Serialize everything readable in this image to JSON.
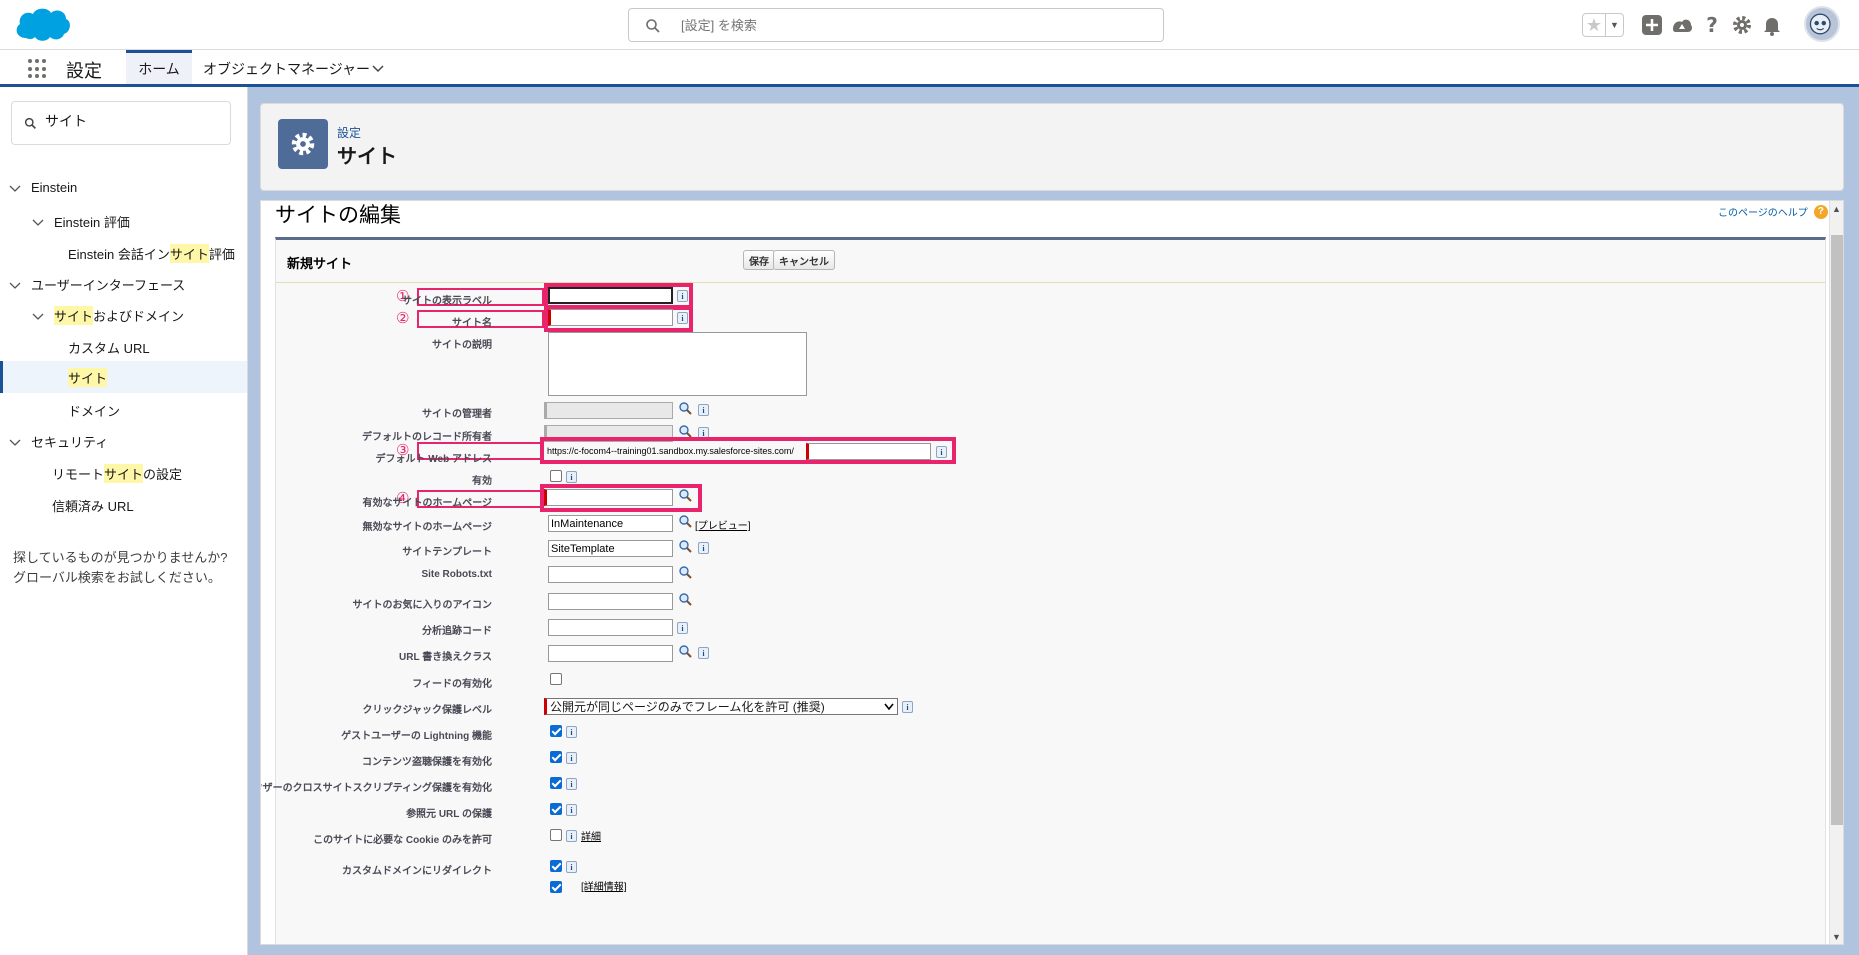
{
  "header": {
    "search_placeholder": "[設定] を検索"
  },
  "nav": {
    "app_name": "設定",
    "home_tab": "ホーム",
    "object_manager_tab": "オブジェクトマネージャー"
  },
  "sidebar": {
    "search_value": "サイト",
    "items": [
      {
        "label": "Einstein"
      },
      {
        "label": "Einstein 評価"
      },
      {
        "label_pre": "Einstein 会話イン",
        "label_hl": "サイト",
        "label_post": "評価"
      },
      {
        "label": "ユーザーインターフェース"
      },
      {
        "label_pre": "",
        "label_hl": "サイト",
        "label_post": "およびドメイン"
      },
      {
        "label": "カスタム URL"
      },
      {
        "label_pre": "",
        "label_hl": "サイト",
        "label_post": ""
      },
      {
        "label": "ドメイン"
      },
      {
        "label": "セキュリティ"
      },
      {
        "label_pre": "リモート",
        "label_hl": "サイト",
        "label_post": "の設定"
      },
      {
        "label": "信頼済み URL"
      }
    ],
    "help_line1": "探しているものが見つかりませんか?",
    "help_line2": "グローバル検索をお試しください。"
  },
  "page_header": {
    "breadcrumb": "設定",
    "title": "サイト"
  },
  "content": {
    "edit_title": "サイトの編集",
    "help_link": "このページのヘルプ",
    "help_icon": "?",
    "section_title": "新規サイト",
    "save_button": "保存",
    "cancel_button": "キャンセル"
  },
  "fields": {
    "site_label": "サイトの表示ラベル",
    "site_name": "サイト名",
    "site_description": "サイトの説明",
    "site_admin": "サイトの管理者",
    "default_owner": "デフォルトのレコード所有者",
    "default_web_address": "デフォルト Web アドレス",
    "default_web_address_prefix": "https://c-focom4--training01.sandbox.my.salesforce-sites.com/",
    "active": "有効",
    "active_home": "有効なサイトのホームページ",
    "inactive_home": "無効なサイトのホームページ",
    "inactive_home_value": "InMaintenance",
    "preview_link": "[プレビュー]",
    "site_template": "サイトテンプレート",
    "site_template_value": "SiteTemplate",
    "robots": "Site Robots.txt",
    "favicon": "サイトのお気に入りのアイコン",
    "analytics": "分析追跡コード",
    "url_rewriter": "URL 書き換えクラス",
    "enable_feeds": "フィードの有効化",
    "clickjack": "クリックジャック保護レベル",
    "clickjack_value": "公開元が同じページのみでフレーム化を許可 (推奨)",
    "guest_lightning": "ゲストユーザーの Lightning 機能",
    "content_sniffing": "コンテンツ盗聴保護を有効化",
    "xss_protection": "ブラウザーのクロスサイトスクリプティング保護を有効化",
    "referrer": "参照元 URL の保護",
    "required_cookies": "このサイトに必要な Cookie のみを許可",
    "details_link": "詳細",
    "custom_domain_redirect": "カスタムドメインにリダイレクト",
    "partial_row_link": "[詳細情報]"
  },
  "annotations": [
    "①",
    "②",
    "③",
    "④"
  ],
  "info_glyph": "i",
  "colors": {
    "accent": "#1b5297",
    "annotation": "#e8246d",
    "highlight": "#fff7a8",
    "checkbox": "#0b6bd4",
    "required": "#cc0000"
  }
}
